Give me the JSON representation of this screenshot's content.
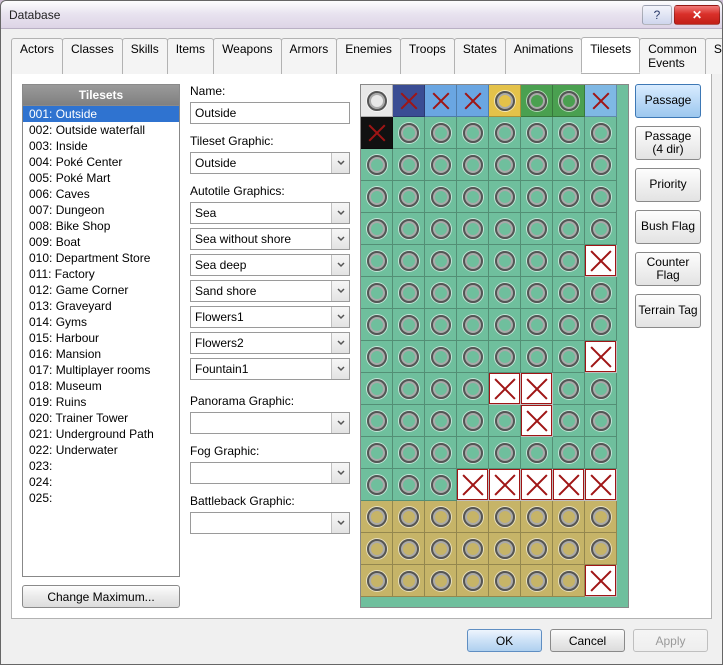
{
  "window": {
    "title": "Database"
  },
  "titlebar": {
    "help_glyph": "?",
    "close_glyph": "✕"
  },
  "tabs": [
    "Actors",
    "Classes",
    "Skills",
    "Items",
    "Weapons",
    "Armors",
    "Enemies",
    "Troops",
    "States",
    "Animations",
    "Tilesets",
    "Common Events",
    "System"
  ],
  "active_tab_index": 10,
  "sidebar": {
    "header": "Tilesets",
    "items": [
      "001: Outside",
      "002: Outside waterfall",
      "003: Inside",
      "004: Poké Center",
      "005: Poké Mart",
      "006: Caves",
      "007: Dungeon",
      "008: Bike Shop",
      "009: Boat",
      "010: Department Store",
      "011: Factory",
      "012: Game Corner",
      "013: Graveyard",
      "014: Gyms",
      "015: Harbour",
      "016: Mansion",
      "017: Multiplayer rooms",
      "018: Museum",
      "019: Ruins",
      "020: Trainer Tower",
      "021: Underground Path",
      "022: Underwater",
      "023:",
      "024:",
      "025:"
    ],
    "selected_index": 0,
    "change_max_label": "Change Maximum..."
  },
  "fields": {
    "name_label": "Name:",
    "name_value": "Outside",
    "tileset_graphic_label": "Tileset Graphic:",
    "tileset_graphic_value": "Outside",
    "autotile_label": "Autotile Graphics:",
    "autotiles": [
      "Sea",
      "Sea without shore",
      "Sea deep",
      "Sand shore",
      "Flowers1",
      "Flowers2",
      "Fountain1"
    ],
    "panorama_label": "Panorama Graphic:",
    "panorama_value": "",
    "fog_label": "Fog Graphic:",
    "fog_value": "",
    "battleback_label": "Battleback Graphic:",
    "battleback_value": ""
  },
  "mode_buttons": [
    "Passage",
    "Passage (4 dir)",
    "Priority",
    "Bush Flag",
    "Counter Flag",
    "Terrain Tag"
  ],
  "active_mode_index": 0,
  "tile_rows": [
    [
      "o",
      "x",
      "x",
      "x",
      "o",
      "o",
      "o",
      "x"
    ],
    [
      "x",
      "o",
      "o",
      "o",
      "o",
      "o",
      "o",
      "o"
    ],
    [
      "o",
      "o",
      "o",
      "o",
      "o",
      "o",
      "o",
      "o"
    ],
    [
      "o",
      "o",
      "o",
      "o",
      "o",
      "o",
      "o",
      "o"
    ],
    [
      "o",
      "o",
      "o",
      "o",
      "o",
      "o",
      "o",
      "o"
    ],
    [
      "o",
      "o",
      "o",
      "o",
      "o",
      "o",
      "o",
      "X"
    ],
    [
      "o",
      "o",
      "o",
      "o",
      "o",
      "o",
      "o",
      "o"
    ],
    [
      "o",
      "o",
      "o",
      "o",
      "o",
      "o",
      "o",
      "o"
    ],
    [
      "o",
      "o",
      "o",
      "o",
      "o",
      "o",
      "o",
      "X"
    ],
    [
      "o",
      "o",
      "o",
      "o",
      "X",
      "X",
      "o",
      "o"
    ],
    [
      "o",
      "o",
      "o",
      "o",
      "o",
      "X",
      "o",
      "o"
    ],
    [
      "o",
      "o",
      "o",
      "o",
      "o",
      "o",
      "o",
      "o"
    ],
    [
      "o",
      "o",
      "o",
      "X",
      "X",
      "X",
      "X",
      "X"
    ],
    [
      "o",
      "o",
      "o",
      "o",
      "o",
      "o",
      "o",
      "o"
    ],
    [
      "o",
      "o",
      "o",
      "o",
      "o",
      "o",
      "o",
      "o"
    ],
    [
      "o",
      "o",
      "o",
      "o",
      "o",
      "o",
      "o",
      "X"
    ]
  ],
  "sand_rows_from": 13,
  "footer": {
    "ok": "OK",
    "cancel": "Cancel",
    "apply": "Apply"
  }
}
